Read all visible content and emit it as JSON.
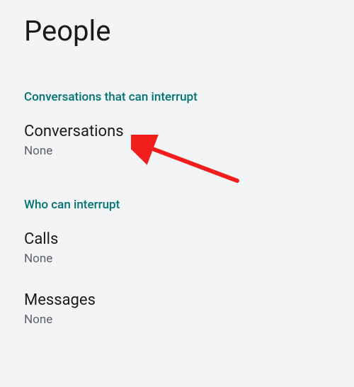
{
  "title": "People",
  "sections": [
    {
      "header": "Conversations that can interrupt",
      "items": [
        {
          "name": "conversations",
          "title": "Conversations",
          "value": "None"
        }
      ]
    },
    {
      "header": "Who can interrupt",
      "items": [
        {
          "name": "calls",
          "title": "Calls",
          "value": "None"
        },
        {
          "name": "messages",
          "title": "Messages",
          "value": "None"
        }
      ]
    }
  ],
  "annotation": {
    "type": "arrow",
    "color": "#f21d1d"
  }
}
